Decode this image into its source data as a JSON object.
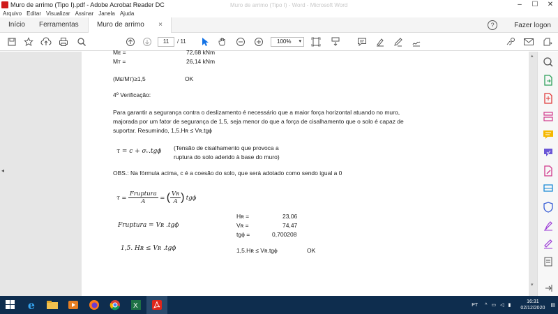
{
  "window": {
    "title": "Muro de arrimo (Tipo I).pdf - Adobe Acrobat Reader DC",
    "ghost_title": "Muro de arrimo (Tipo I) - Word - Microsoft Word",
    "controls": [
      "–",
      "☐",
      "✕"
    ]
  },
  "menu": [
    "Arquivo",
    "Editar",
    "Visualizar",
    "Assinar",
    "Janela",
    "Ajuda"
  ],
  "tabs": {
    "home": "Início",
    "tools": "Ferramentas",
    "document": "Muro de arrimo (Ti...",
    "document_close": "×"
  },
  "header_right": {
    "help": "?",
    "login": "Fazer logon"
  },
  "toolbar": {
    "page_current": "11",
    "page_total": "/ 11",
    "zoom": "100%",
    "icons": [
      "save-icon",
      "star-icon",
      "upload-icon",
      "print-icon",
      "search-icon",
      "prev-page-icon",
      "next-page-icon",
      "select-cursor-icon",
      "hand-icon",
      "zoom-out-icon",
      "zoom-in-icon",
      "fit-page-icon",
      "scroll-mode-icon",
      "comment-icon",
      "highlight-icon",
      "pen-icon",
      "sign-icon",
      "share-link-icon",
      "email-icon",
      "attach-icon"
    ]
  },
  "document": {
    "top_lines": [
      {
        "label": "Mᴇ =",
        "value": "72,68 kNm"
      },
      {
        "label": "Mᴛ =",
        "value": "26,14 kNm"
      }
    ],
    "ratio_check": {
      "expr": "(Mᴇ/Mᴛ)≥1,5",
      "result": "OK"
    },
    "section_title": "4º Verificação:",
    "paragraph": [
      "Para garantir a segurança contra o deslizamento é necessário que a maior força horizontal atuando no muro,",
      "majorada por um fator de segurança de 1,5, seja menor do que a força de cisalhamento que o solo é capaz de",
      "suportar. Resumindo, 1,5.Hʀ ≤ Vʀ.tgϕ"
    ],
    "formula_tau": "τ = c + σᵥ.tgϕ",
    "tau_note": [
      "(Tensão de cisalhamento que provoca a",
      "ruptura do solo aderido à base do muro)"
    ],
    "obs": "OBS.: Na fórmula acima, c é a coesão do solo, que será adotado como sendo igual a 0",
    "formula_frac": {
      "lhs": "τ =",
      "num1": "Fruptura",
      "den1": "A",
      "eq": "=",
      "num2": "Vʀ",
      "den2": "A",
      "tail": "tgϕ"
    },
    "formula_fr": "Fruptura = Vʀ .tgϕ",
    "formula_check": "1,5. Hʀ ≤ Vʀ .tgϕ",
    "values": [
      {
        "label": "Hʀ =",
        "value": "23,06"
      },
      {
        "label": "Vʀ =",
        "value": "74,47"
      },
      {
        "label": "tgϕ =",
        "value": "0,700208"
      }
    ],
    "final_check": {
      "expr": "1,5.Hʀ ≤ Vʀ.tgϕ",
      "result": "OK"
    }
  },
  "taskbar": {
    "apps": [
      "start-icon",
      "search-icon",
      "task-view-icon",
      "ie-icon",
      "file-explorer-icon",
      "media-player-icon",
      "firefox-icon",
      "chrome-icon",
      "excel-icon",
      "acrobat-icon"
    ],
    "lang": "PT",
    "time": "16:31",
    "date": "02/12/2020"
  }
}
